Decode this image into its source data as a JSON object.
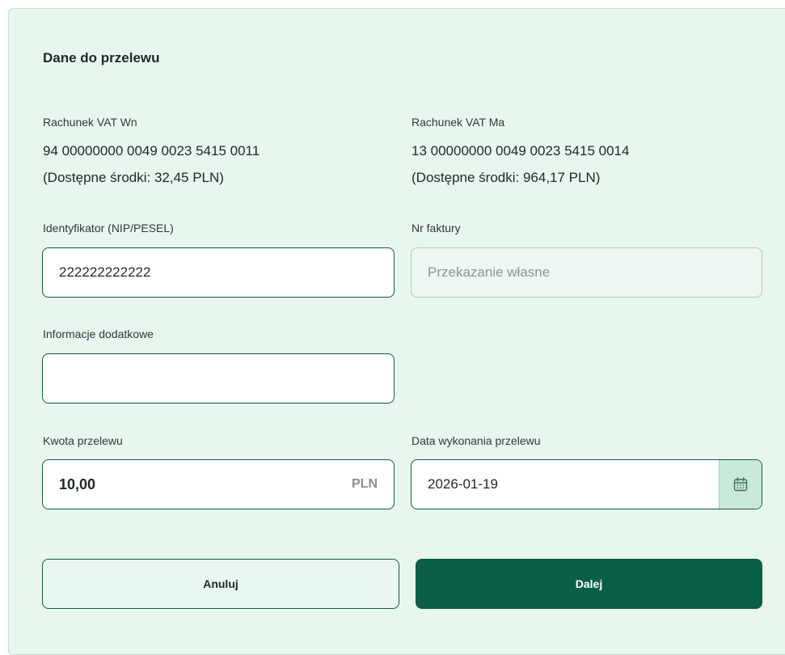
{
  "section_title": "Dane do przelewu",
  "vat_wn": {
    "label": "Rachunek VAT Wn",
    "account": "94 00000000 0049 0023 5415 0011",
    "available": "(Dostępne środki: 32,45 PLN)"
  },
  "vat_ma": {
    "label": "Rachunek VAT Ma",
    "account": "13 00000000 0049 0023 5415 0014",
    "available": "(Dostępne środki: 964,17 PLN)"
  },
  "identifier": {
    "label": "Identyfikator (NIP/PESEL)",
    "value": "222222222222"
  },
  "invoice": {
    "label": "Nr faktury",
    "value": "Przekazanie własne"
  },
  "additional_info": {
    "label": "Informacje dodatkowe",
    "value": ""
  },
  "amount": {
    "label": "Kwota przelewu",
    "value": "10,00",
    "currency": "PLN"
  },
  "execution_date": {
    "label": "Data wykonania przelewu",
    "value": "2026-01-19",
    "icon": "calendar-icon"
  },
  "actions": {
    "cancel_label": "Anuluj",
    "next_label": "Dalej"
  },
  "colors": {
    "panel_bg": "#e8f6ee",
    "primary": "#0b5f47",
    "calendar_bg": "#c9ead8"
  }
}
